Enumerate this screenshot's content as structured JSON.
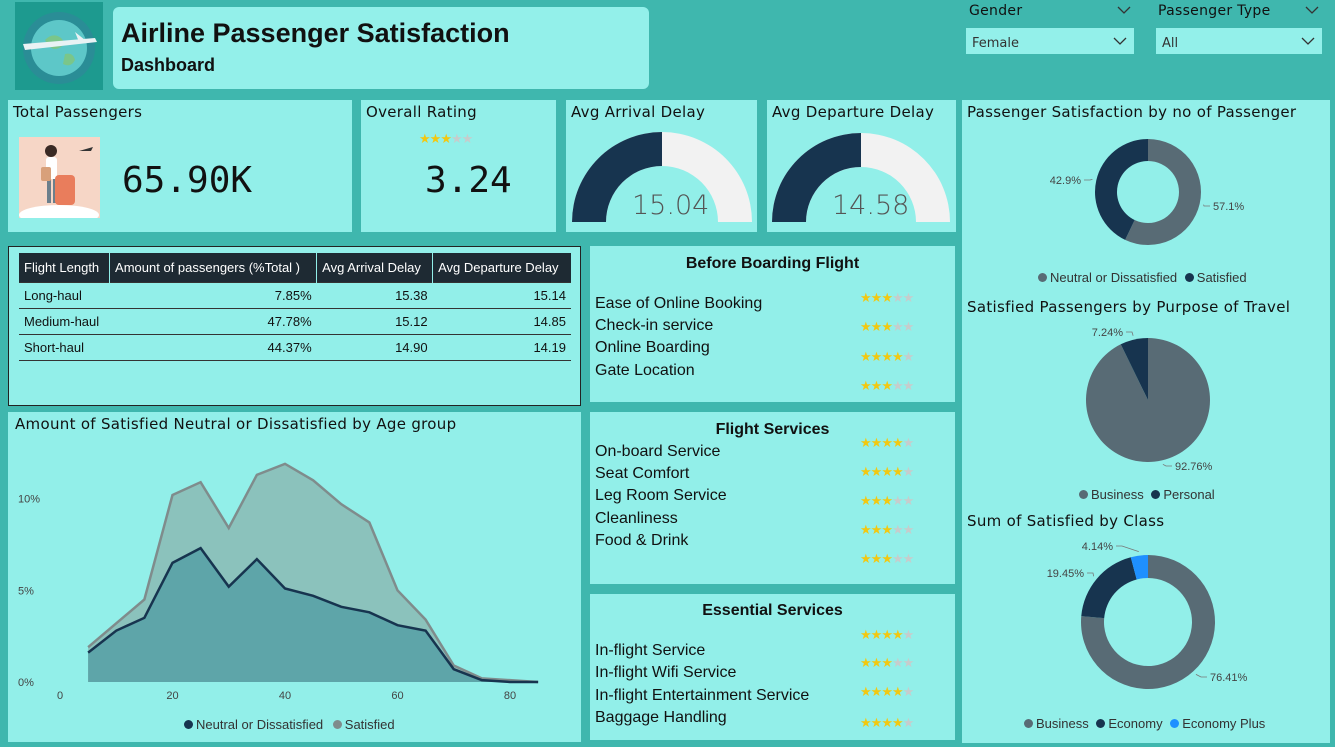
{
  "header": {
    "title": "Airline Passenger Satisfaction",
    "subtitle": "Dashboard"
  },
  "slicers": {
    "gender": {
      "label": "Gender",
      "value": "Female"
    },
    "passenger_type": {
      "label": "Passenger Type",
      "value": "All"
    }
  },
  "kpis": {
    "total_passengers": {
      "label": "Total Passengers",
      "value": "65.90K"
    },
    "overall_rating": {
      "label": "Overall Rating",
      "value": "3.24",
      "stars": 3.24
    },
    "avg_arrival_delay": {
      "label": "Avg Arrival Delay",
      "value": "15.04"
    },
    "avg_departure_delay": {
      "label": "Avg Departure Delay",
      "value": "14.58"
    }
  },
  "flight_table": {
    "headers": [
      "Flight Length",
      "Amount of passengers (%Total )",
      "Avg Arrival Delay",
      "Avg Departure Delay"
    ],
    "rows": [
      [
        "Long-haul",
        "7.85%",
        "15.38",
        "15.14"
      ],
      [
        "Medium-haul",
        "47.78%",
        "15.12",
        "14.85"
      ],
      [
        "Short-haul",
        "44.37%",
        "14.90",
        "14.19"
      ]
    ]
  },
  "services": {
    "before_boarding": {
      "title": "Before Boarding Flight",
      "items": [
        "Ease of Online Booking",
        "Check-in service",
        "Online Boarding",
        "Gate Location"
      ],
      "ratings": [
        3,
        3,
        3.5,
        3
      ]
    },
    "flight_services": {
      "title": "Flight Services",
      "items": [
        "On-board Service",
        "Seat Comfort",
        "Leg Room Service",
        "Cleanliness",
        "Food & Drink"
      ],
      "ratings": [
        3.5,
        3.5,
        3,
        3,
        3
      ]
    },
    "essential_services": {
      "title": "Essential Services",
      "items": [
        "In-flight Service",
        "In-flight Wifi Service",
        "In-flight Entertainment Service",
        "Baggage Handling"
      ],
      "ratings": [
        3.5,
        3,
        3.5,
        3.5
      ]
    }
  },
  "colors": {
    "dark": "#17344f",
    "grey": "#586b75",
    "blue": "#1e90ff",
    "area_back": "#8bc2bc",
    "area_front": "#5ea5a9",
    "star": "#f2c811"
  },
  "chart_data": [
    {
      "type": "area",
      "title": "Amount of Satisfied Neutral or Dissatisfied by Age group",
      "x": [
        5,
        10,
        15,
        20,
        25,
        30,
        35,
        40,
        45,
        50,
        55,
        60,
        65,
        70,
        75,
        80,
        85
      ],
      "series": [
        {
          "name": "Satisfied",
          "values": [
            1.9,
            3.2,
            4.5,
            10.2,
            10.9,
            8.4,
            11.3,
            11.9,
            11.0,
            9.7,
            8.7,
            5.0,
            3.4,
            0.9,
            0.2,
            0.1,
            0.0
          ]
        },
        {
          "name": "Neutral or Dissatisfied",
          "values": [
            1.6,
            2.8,
            3.5,
            6.5,
            7.3,
            5.2,
            6.7,
            5.1,
            4.7,
            4.1,
            3.8,
            3.1,
            2.8,
            0.7,
            0.1,
            0.0,
            0.0
          ]
        }
      ],
      "xticks": [
        0,
        20,
        40,
        60,
        80
      ],
      "ytick_labels": [
        "0%",
        "5%",
        "10%"
      ],
      "ylim": [
        0,
        12
      ]
    },
    {
      "type": "pie",
      "title": "Passenger Satisfaction by no of Passenger",
      "categories": [
        "Neutral or Dissatisfied",
        "Satisfied"
      ],
      "values": [
        57.1,
        42.9
      ],
      "labels": [
        "57.1%",
        "42.9%"
      ]
    },
    {
      "type": "pie",
      "title": "Satisfied Passengers by Purpose of Travel",
      "categories": [
        "Business",
        "Personal"
      ],
      "values": [
        92.76,
        7.24
      ],
      "labels": [
        "92.76%",
        "7.24%"
      ]
    },
    {
      "type": "pie",
      "title": "Sum of Satisfied by Class",
      "categories": [
        "Business",
        "Economy",
        "Economy Plus"
      ],
      "values": [
        76.41,
        19.45,
        4.14
      ],
      "labels": [
        "76.41%",
        "19.45%",
        "4.14%"
      ]
    }
  ]
}
